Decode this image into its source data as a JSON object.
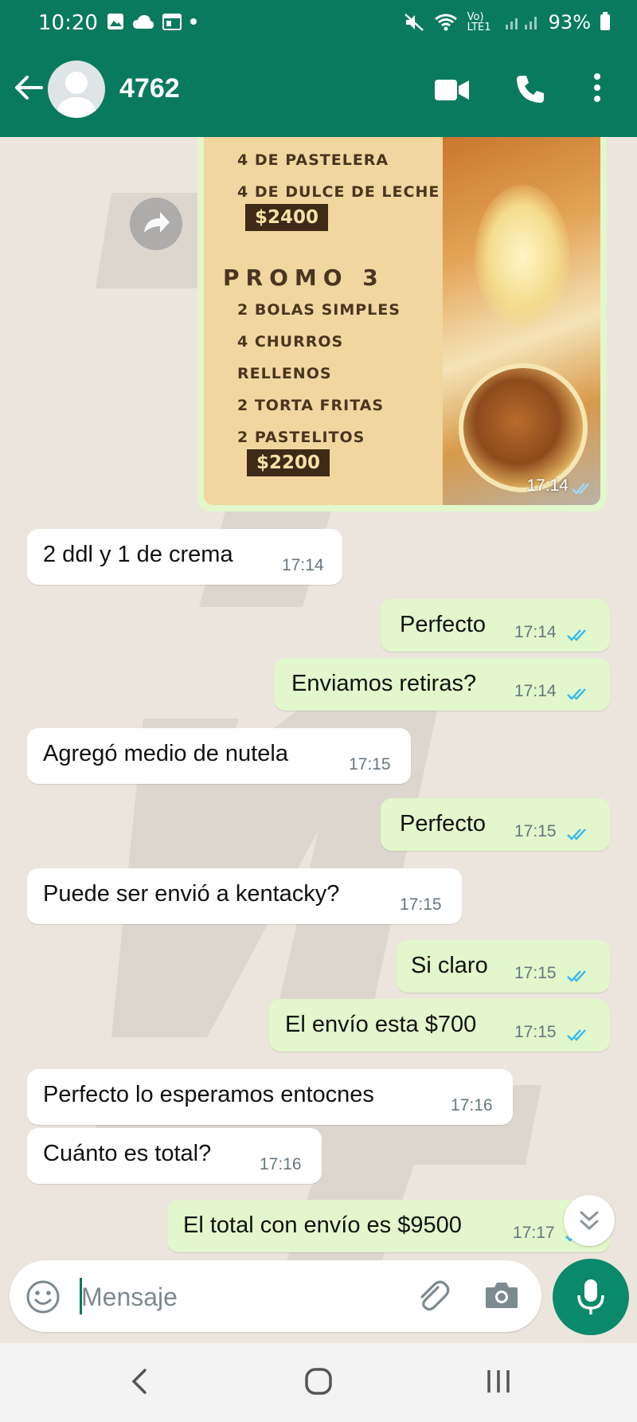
{
  "status_bar": {
    "time": "10:20",
    "network": "Vo) LTE1",
    "battery": "93%"
  },
  "header": {
    "contact_name": "4762"
  },
  "image_message": {
    "lines_top": [
      "4 DE PASTELERA",
      "4 DE DULCE DE LECHE"
    ],
    "price_1": "$2400",
    "promo_title": "PROMO 3",
    "promo_items": [
      "2 BOLAS SIMPLES",
      "4 CHURROS",
      "RELLENOS",
      "2 TORTA FRITAS",
      "2 PASTELITOS"
    ],
    "price_2": "$2200",
    "time": "17:14"
  },
  "messages": [
    {
      "dir": "in",
      "text": "2 ddl y 1 de crema",
      "time": "17:14"
    },
    {
      "dir": "out",
      "text": "Perfecto",
      "time": "17:14"
    },
    {
      "dir": "out",
      "text": "Enviamos retiras?",
      "time": "17:14"
    },
    {
      "dir": "in",
      "text": "Agregó medio de nutela",
      "time": "17:15"
    },
    {
      "dir": "out",
      "text": "Perfecto",
      "time": "17:15"
    },
    {
      "dir": "in",
      "text": "Puede ser envió a kentacky?",
      "time": "17:15"
    },
    {
      "dir": "out",
      "text": "Si claro",
      "time": "17:15"
    },
    {
      "dir": "out",
      "text": "El envío esta $700",
      "time": "17:15"
    },
    {
      "dir": "in",
      "text": "Perfecto lo esperamos entocnes",
      "time": "17:16"
    },
    {
      "dir": "in",
      "text": "Cuánto es total?",
      "time": "17:16"
    },
    {
      "dir": "out",
      "text": "El total con envío es $9500",
      "time": "17:17"
    }
  ],
  "input": {
    "placeholder": "Mensaje"
  },
  "colors": {
    "header": "#0a7a5e",
    "outgoing_bubble": "#e2f7cb",
    "incoming_bubble": "#ffffff",
    "chat_bg": "#ece5dd",
    "read_ticks": "#34b7f1"
  }
}
